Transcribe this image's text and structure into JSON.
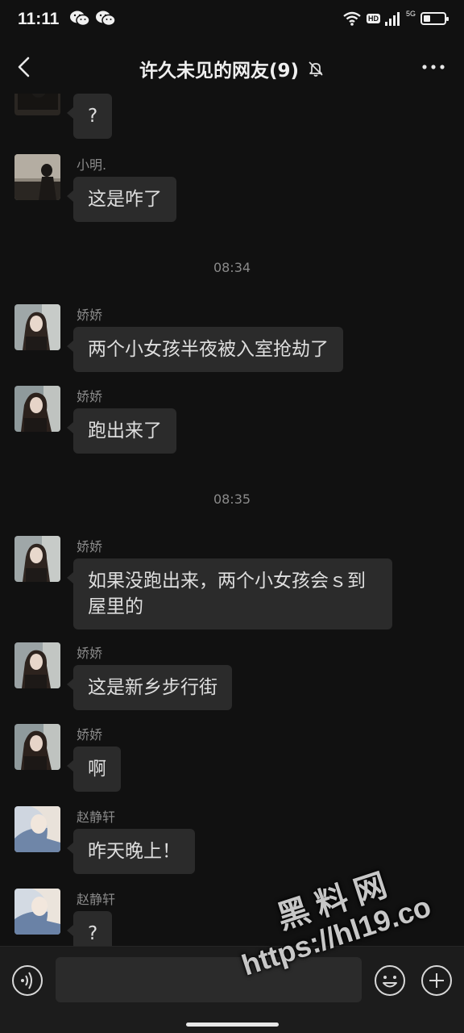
{
  "status_bar": {
    "time": "11:11",
    "hd": "HD",
    "network": "5G",
    "battery_level": 0.35,
    "icons": [
      "wechat-icon",
      "wechat-icon",
      "wifi-icon",
      "signal-icon",
      "battery-icon"
    ]
  },
  "header": {
    "title": "许久未见的网友(9)",
    "icons": [
      "back-arrow-icon",
      "mute-bell-icon",
      "more-dots-icon"
    ]
  },
  "messages": [
    {
      "sender": "",
      "text": "?",
      "avatar": "avatar-dark"
    },
    {
      "sender": "小明.",
      "text": "这是咋了",
      "avatar": "avatar-dark"
    },
    {
      "sender": "娇娇",
      "text": "两个小女孩半夜被入室抢劫了",
      "avatar": "avatar-girl"
    },
    {
      "sender": "娇娇",
      "text": "跑出来了",
      "avatar": "avatar-girl"
    },
    {
      "sender": "娇娇",
      "text": "如果没跑出来，两个小女孩会ｓ到屋里的",
      "line1": "如果没跑出来，两个小女孩会ｓ到",
      "line2": "屋里的",
      "avatar": "avatar-girl"
    },
    {
      "sender": "娇娇",
      "text": "这是新乡步行街",
      "avatar": "avatar-girl"
    },
    {
      "sender": "娇娇",
      "text": "啊",
      "avatar": "avatar-girl"
    },
    {
      "sender": "赵静轩",
      "text": "昨天晚上！",
      "avatar": "avatar-light"
    },
    {
      "sender": "赵静轩",
      "text": "?",
      "avatar": "avatar-light"
    }
  ],
  "timestamps": [
    "08:34",
    "08:35"
  ],
  "input_bar": {
    "placeholder": "",
    "icons": [
      "voice-icon",
      "emoji-icon",
      "plus-icon"
    ]
  },
  "watermark": {
    "chinese": "黑料网",
    "url": "https://hl19.co"
  },
  "colors": {
    "background": "#111111",
    "bubble": "#2b2b2b",
    "text": "#dedede",
    "meta": "#8a8a8a"
  }
}
